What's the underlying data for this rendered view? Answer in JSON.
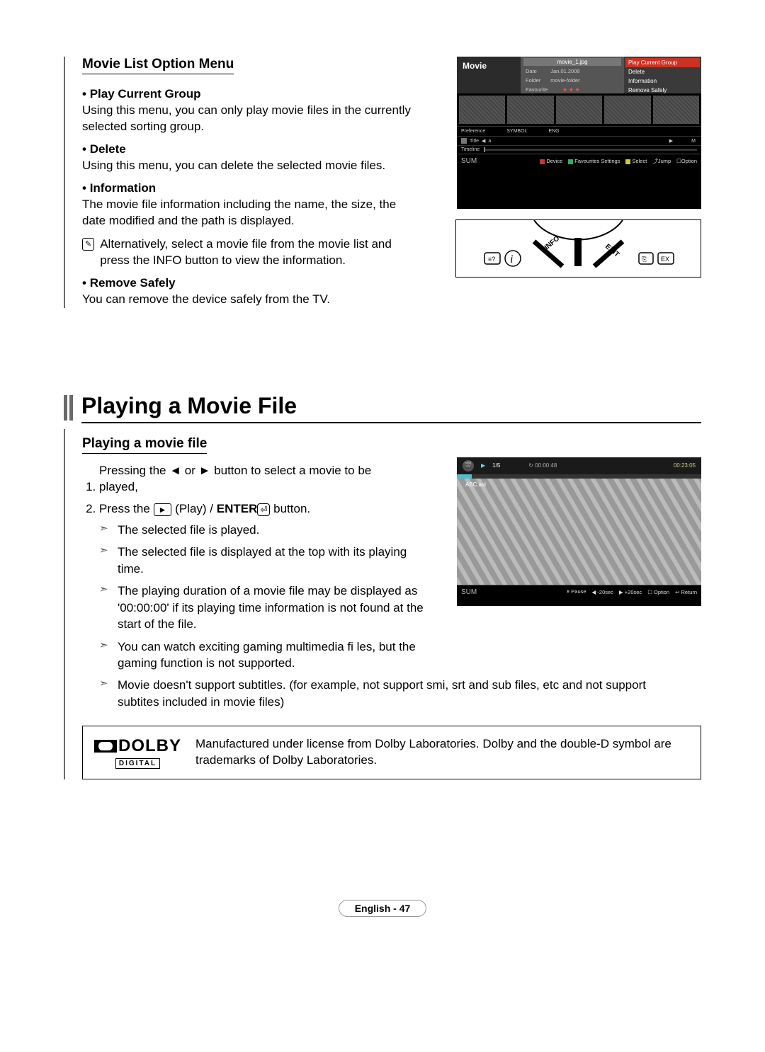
{
  "section1": {
    "title": "Movie List Option Menu",
    "items": {
      "playCurrentGroup": {
        "head": "Play Current Group",
        "body": "Using this menu, you can only play movie files in the currently selected sorting group."
      },
      "delete": {
        "head": "Delete",
        "body": "Using this menu, you can delete the selected movie files."
      },
      "information": {
        "head": "Information",
        "body": "The movie file information including the name, the size, the date modified and the path is displayed."
      },
      "note": "Alternatively, select a movie file from the movie list and press the INFO button to view the information.",
      "removeSafely": {
        "head": "Remove Safely",
        "body": "You can remove the device safely from the TV."
      }
    }
  },
  "tv1": {
    "app": "Movie",
    "filename": "movie_1.jpg",
    "meta": {
      "dateLabel": "Date",
      "dateVal": "Jan.01.2008",
      "folderLabel": "Folder",
      "folderVal": "movie-folder",
      "favLabel": "Favourite",
      "favVal": "★ ★ ★"
    },
    "options": [
      "Play Current Group",
      "Delete",
      "Information",
      "Remove Safely"
    ],
    "bars": {
      "pref": "Preference",
      "symbol": "SYMBOL",
      "eng": "ENG",
      "titleLab": "Title",
      "titleA": "a",
      "titleM": "M",
      "timeline": "Timeline"
    },
    "sum": "SUM",
    "legend": [
      "Device",
      "Favourites Settings",
      "Select",
      "Jump",
      "Option"
    ]
  },
  "remote": {
    "info": "INFO",
    "exit": "EXIT"
  },
  "heading2": "Playing a Movie File",
  "section2": {
    "title": "Playing a movie file",
    "step1": "Pressing the ◄ or ► button to select a movie to be played,",
    "step2_a": "Press the ",
    "step2_play": "►",
    "step2_b": " (Play) / ",
    "step2_enter": "ENTER",
    "step2_entersym": "⏎",
    "step2_c": " button.",
    "subs": [
      "The selected file is played.",
      "The selected file is displayed at the top with its playing time.",
      "The playing duration of a movie file may be displayed as '00:00:00' if its playing time information is not found at the start of the file.",
      "You can watch exciting gaming multimedia fi les, but the gaming function is not supported.",
      "Movie doesn't support subtitles. (for example, not support smi, srt and sub files, etc and not support subtites included in movie files)"
    ]
  },
  "tv2": {
    "index": "1/5",
    "elapsed": "00:00:48",
    "total": "00:23:05",
    "filename": "ABC.avi",
    "sum": "SUM",
    "legend": [
      "Pause",
      "-20sec",
      "+20sec",
      "Option",
      "Return"
    ]
  },
  "dolby": {
    "brand": "DOLBY",
    "digital": "DIGITAL",
    "text": "Manufactured under license from Dolby Laboratories. Dolby and the double-D symbol are trademarks of Dolby Laboratories."
  },
  "footer": "English - 47"
}
